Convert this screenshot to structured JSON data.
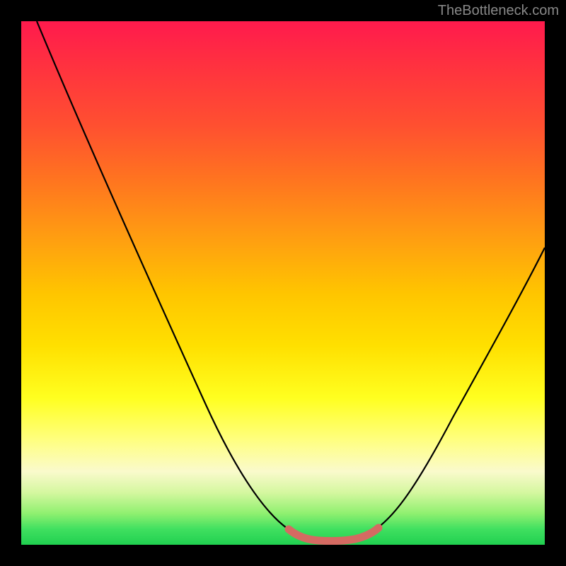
{
  "watermark": "TheBottleneck.com",
  "chart_data": {
    "type": "line",
    "title": "",
    "xlabel": "",
    "ylabel": "",
    "xlim": [
      0,
      100
    ],
    "ylim": [
      0,
      100
    ],
    "series": [
      {
        "name": "bottleneck-curve",
        "x": [
          3,
          10,
          20,
          30,
          40,
          48,
          52,
          55,
          58,
          60,
          62,
          65,
          68,
          75,
          85,
          95,
          100
        ],
        "y": [
          100,
          84,
          66,
          48,
          30,
          15,
          8,
          4,
          2,
          1.5,
          2,
          4,
          8,
          18,
          34,
          50,
          58
        ]
      },
      {
        "name": "highlight-band",
        "x": [
          52,
          55,
          58,
          60,
          62,
          65,
          68
        ],
        "y": [
          8,
          4,
          2,
          1.5,
          2,
          4,
          8
        ]
      }
    ],
    "gradient_stops": [
      {
        "pos": 0,
        "color": "#ff1a4d"
      },
      {
        "pos": 50,
        "color": "#ffc500"
      },
      {
        "pos": 80,
        "color": "#ffff80"
      },
      {
        "pos": 100,
        "color": "#20d050"
      }
    ]
  }
}
